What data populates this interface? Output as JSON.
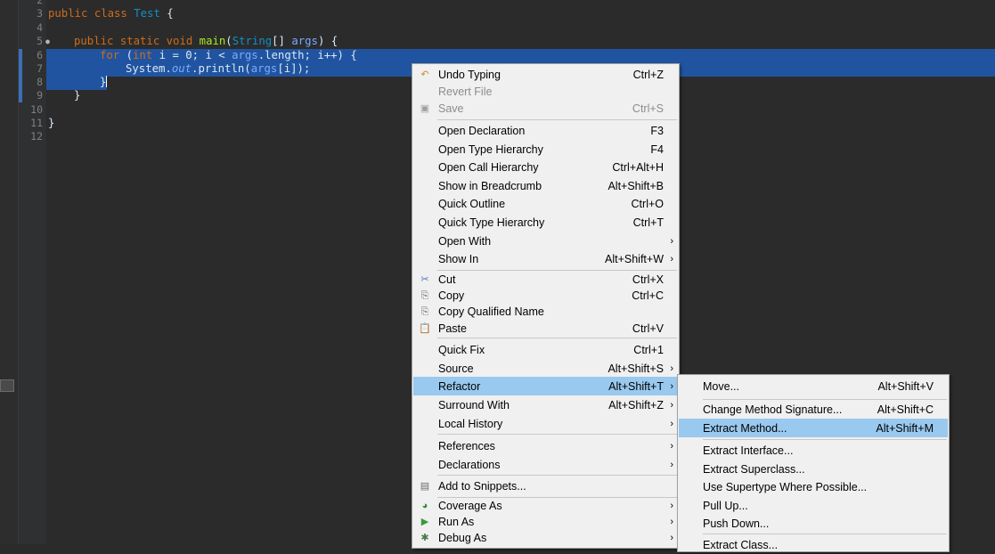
{
  "editor": {
    "line_numbers": [
      "2",
      "3",
      "4",
      "5",
      "6",
      "7",
      "8",
      "9",
      "10",
      "11",
      "12"
    ],
    "fold_marker": "●",
    "code": {
      "l3": {
        "kw": "public class ",
        "cls": "Test",
        "rest": " {"
      },
      "l5": {
        "kw1": "public static void ",
        "mth": "main",
        "p1": "(",
        "type": "String",
        "p2": "[] ",
        "param": "args",
        "p3": ") {"
      },
      "l6": {
        "kw": "for",
        "p1": " (",
        "kw2": "int",
        "p2": " i = 0; i < ",
        "param": "args",
        "p3": ".length; i++) {"
      },
      "l7": {
        "p1": "System.",
        "italic": "out",
        "p2": ".println(",
        "param": "args",
        "p3": "[i]);"
      },
      "l8": {
        "brace": "}"
      },
      "l9": {
        "brace": "}"
      },
      "l11": {
        "brace": "}"
      }
    }
  },
  "context_menu": {
    "items": [
      {
        "icon": "↶",
        "label": "Undo Typing",
        "shortcut": "Ctrl+Z"
      },
      {
        "icon": "",
        "label": "Revert File",
        "shortcut": ""
      },
      {
        "icon": "▣",
        "label": "Save",
        "shortcut": "Ctrl+S"
      },
      {
        "icon": "",
        "label": "Open Declaration",
        "shortcut": "F3"
      },
      {
        "icon": "",
        "label": "Open Type Hierarchy",
        "shortcut": "F4"
      },
      {
        "icon": "",
        "label": "Open Call Hierarchy",
        "shortcut": "Ctrl+Alt+H"
      },
      {
        "icon": "",
        "label": "Show in Breadcrumb",
        "shortcut": "Alt+Shift+B"
      },
      {
        "icon": "",
        "label": "Quick Outline",
        "shortcut": "Ctrl+O"
      },
      {
        "icon": "",
        "label": "Quick Type Hierarchy",
        "shortcut": "Ctrl+T"
      },
      {
        "icon": "",
        "label": "Open With",
        "shortcut": ""
      },
      {
        "icon": "",
        "label": "Show In",
        "shortcut": "Alt+Shift+W"
      },
      {
        "icon": "✂",
        "label": "Cut",
        "shortcut": "Ctrl+X"
      },
      {
        "icon": "⎘",
        "label": "Copy",
        "shortcut": "Ctrl+C"
      },
      {
        "icon": "⎘",
        "label": "Copy Qualified Name",
        "shortcut": ""
      },
      {
        "icon": "📋",
        "label": "Paste",
        "shortcut": "Ctrl+V"
      },
      {
        "icon": "",
        "label": "Quick Fix",
        "shortcut": "Ctrl+1"
      },
      {
        "icon": "",
        "label": "Source",
        "shortcut": "Alt+Shift+S"
      },
      {
        "icon": "",
        "label": "Refactor",
        "shortcut": "Alt+Shift+T"
      },
      {
        "icon": "",
        "label": "Surround With",
        "shortcut": "Alt+Shift+Z"
      },
      {
        "icon": "",
        "label": "Local History",
        "shortcut": ""
      },
      {
        "icon": "",
        "label": "References",
        "shortcut": ""
      },
      {
        "icon": "",
        "label": "Declarations",
        "shortcut": ""
      },
      {
        "icon": "▤",
        "label": "Add to Snippets...",
        "shortcut": ""
      },
      {
        "icon": "◕",
        "label": "Coverage As",
        "shortcut": ""
      },
      {
        "icon": "▶",
        "label": "Run As",
        "shortcut": ""
      },
      {
        "icon": "✱",
        "label": "Debug As",
        "shortcut": ""
      }
    ],
    "arrow": "›"
  },
  "refactor_submenu": {
    "items": [
      {
        "label": "Move...",
        "shortcut": "Alt+Shift+V"
      },
      {
        "label": "Change Method Signature...",
        "shortcut": "Alt+Shift+C"
      },
      {
        "label": "Extract Method...",
        "shortcut": "Alt+Shift+M"
      },
      {
        "label": "Extract Interface...",
        "shortcut": ""
      },
      {
        "label": "Extract Superclass...",
        "shortcut": ""
      },
      {
        "label": "Use Supertype Where Possible...",
        "shortcut": ""
      },
      {
        "label": "Pull Up...",
        "shortcut": ""
      },
      {
        "label": "Push Down...",
        "shortcut": ""
      },
      {
        "label": "Extract Class...",
        "shortcut": ""
      }
    ]
  },
  "colors": {
    "selection": "#2154a0",
    "menu_highlight": "#99c9ef",
    "menu_bg": "#f0f0f0"
  }
}
